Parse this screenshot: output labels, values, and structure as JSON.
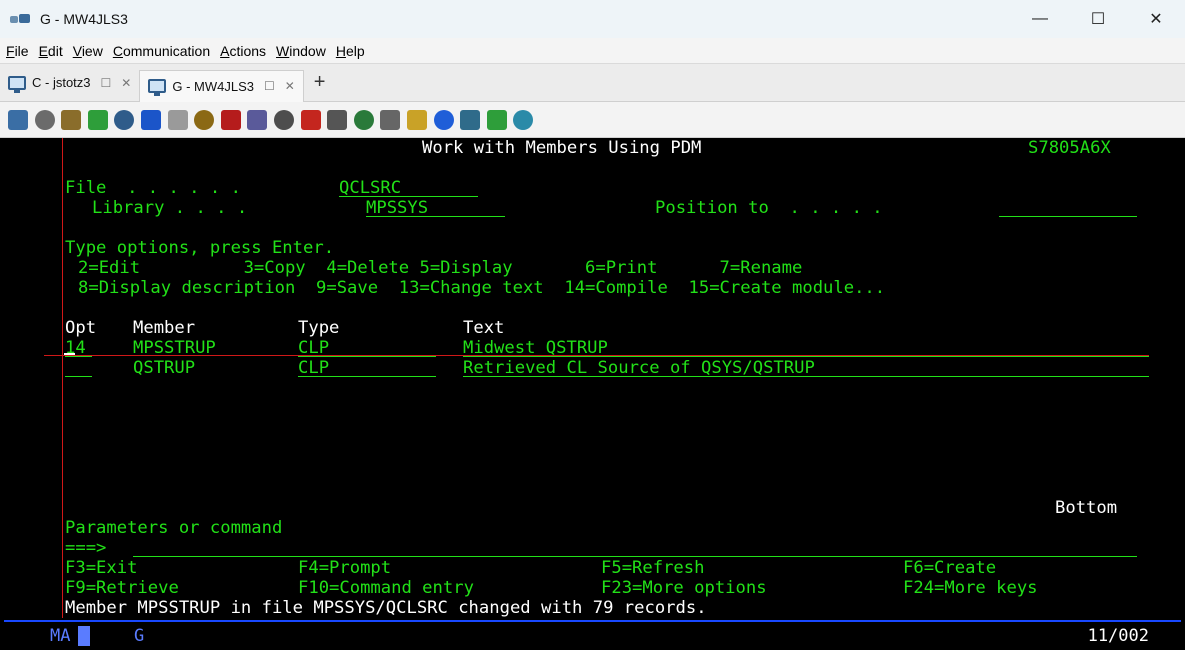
{
  "window": {
    "title": "G - MW4JLS3",
    "minimize_glyph": "—",
    "maximize_glyph": "☐",
    "close_glyph": "✕"
  },
  "menu": {
    "items": [
      {
        "ul": "F",
        "rest": "ile"
      },
      {
        "ul": "E",
        "rest": "dit"
      },
      {
        "ul": "V",
        "rest": "iew"
      },
      {
        "ul": "C",
        "rest": "ommunication"
      },
      {
        "ul": "A",
        "rest": "ctions"
      },
      {
        "ul": "W",
        "rest": "indow"
      },
      {
        "ul": "H",
        "rest": "elp"
      }
    ]
  },
  "tabs": [
    {
      "label": "C - jstotz3"
    },
    {
      "label": "G - MW4JLS3"
    }
  ],
  "tab_add_glyph": "+",
  "tab_ctl_glyphs": {
    "restore": "☐",
    "close": "✕"
  },
  "toolbar": {
    "icons": [
      {
        "name": "copy-screen-icon",
        "color": "#3a6ea5"
      },
      {
        "name": "copy-icon",
        "color": "#6b6b6b"
      },
      {
        "name": "paste-icon",
        "color": "#8a6d2b"
      },
      {
        "name": "download-icon",
        "color": "#2e9e3a"
      },
      {
        "name": "save-icon",
        "color": "#2f5c8a"
      },
      {
        "name": "navigate-icon",
        "color": "#1b55c9"
      },
      {
        "name": "notes-icon",
        "color": "#9a9a9a"
      },
      {
        "name": "package-icon",
        "color": "#8b6914"
      },
      {
        "name": "sql-icon",
        "color": "#b51c1c"
      },
      {
        "name": "keyboard-icon",
        "color": "#5a5a9a"
      },
      {
        "name": "tools-icon",
        "color": "#4d4d4d"
      },
      {
        "name": "record-macro-icon",
        "color": "#c4261e"
      },
      {
        "name": "stop-macro-icon",
        "color": "#555555"
      },
      {
        "name": "play-macro-icon",
        "color": "#2a7a3a"
      },
      {
        "name": "macro-list-icon",
        "color": "#666666"
      },
      {
        "name": "document-icon",
        "color": "#c9a227"
      },
      {
        "name": "help-icon",
        "color": "#1f5ed8"
      },
      {
        "name": "settings-icon",
        "color": "#2f6b8a"
      },
      {
        "name": "upload-icon",
        "color": "#2e9e3a"
      },
      {
        "name": "display-icon",
        "color": "#2a8aa8"
      }
    ]
  },
  "terminal": {
    "header_title": "Work with Members Using PDM",
    "system_name": "S7805A6X",
    "file_label": "File  . . . . . .",
    "file_value": "QCLSRC",
    "library_label": "Library . . . .",
    "library_value": "MPSSYS",
    "position_label": "Position to  . . . . .",
    "position_value": "",
    "instructions": "Type options, press Enter.",
    "options_line1": "2=Edit          3=Copy  4=Delete 5=Display       6=Print      7=Rename",
    "options_line2": "8=Display description  9=Save  13=Change text  14=Compile  15=Create module...",
    "col_opt": "Opt",
    "col_member": "Member",
    "col_type": "Type",
    "col_text": "Text",
    "rows": [
      {
        "opt": "14",
        "member": "MPSSTRUP",
        "type": "CLP",
        "text": "Midwest QSTRUP"
      },
      {
        "opt": "",
        "member": "QSTRUP",
        "type": "CLP",
        "text": "Retrieved CL Source of QSYS/QSTRUP"
      }
    ],
    "bottom_indicator": "Bottom",
    "params_label": "Parameters or command",
    "prompt": "===>",
    "command_value": "",
    "fkeys_line1": [
      "F3=Exit",
      "F4=Prompt",
      "F5=Refresh",
      "F6=Create"
    ],
    "fkeys_line2": [
      "F9=Retrieve",
      "F10=Command entry",
      "F23=More options",
      "F24=More keys"
    ],
    "message": "Member MPSSTRUP in file MPSSYS/QCLSRC changed with 79 records."
  },
  "oia": {
    "ma": "MA",
    "session": "G",
    "cursor_pos": "11/002"
  },
  "colors": {
    "terminal_green": "#22e018",
    "terminal_white": "#ffffff",
    "oia_blue": "#5a7cff",
    "ruler_red": "#d01818"
  }
}
